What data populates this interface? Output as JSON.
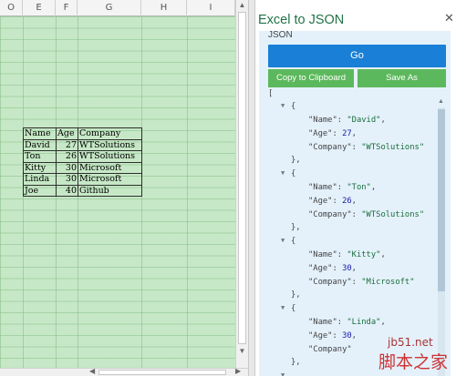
{
  "sheet": {
    "columns": [
      "O",
      "E",
      "F",
      "G",
      "H",
      "I"
    ],
    "table": {
      "headers": [
        "Name",
        "Age",
        "Company"
      ],
      "rows": [
        [
          "David",
          "27",
          "WTSolutions"
        ],
        [
          "Ton",
          "26",
          "WTSolutions"
        ],
        [
          "Kitty",
          "30",
          "Microsoft"
        ],
        [
          "Linda",
          "30",
          "Microsoft"
        ],
        [
          "Joe",
          "40",
          "Github"
        ]
      ]
    }
  },
  "pane": {
    "title": "Excel to JSON",
    "section_label": "JSON",
    "go_label": "Go",
    "copy_label": "Copy to Clipboard",
    "save_label": "Save As",
    "json_keys": {
      "name": "\"Name\"",
      "age": "\"Age\"",
      "company": "\"Company\""
    },
    "json_records": [
      {
        "name": "\"David\"",
        "age": "27",
        "company": "\"WTSolutions\""
      },
      {
        "name": "\"Ton\"",
        "age": "26",
        "company": "\"WTSolutions\""
      },
      {
        "name": "\"Kitty\"",
        "age": "30",
        "company": "\"Microsoft\""
      },
      {
        "name": "\"Linda\"",
        "age": "30",
        "company": ""
      }
    ]
  },
  "watermark": {
    "site": "jb51.net",
    "text": "脚本之家"
  },
  "colors": {
    "accent": "#217346",
    "go": "#1a7fd6",
    "green_button": "#5cb85c",
    "sheet_bg": "#c6e8c6"
  }
}
